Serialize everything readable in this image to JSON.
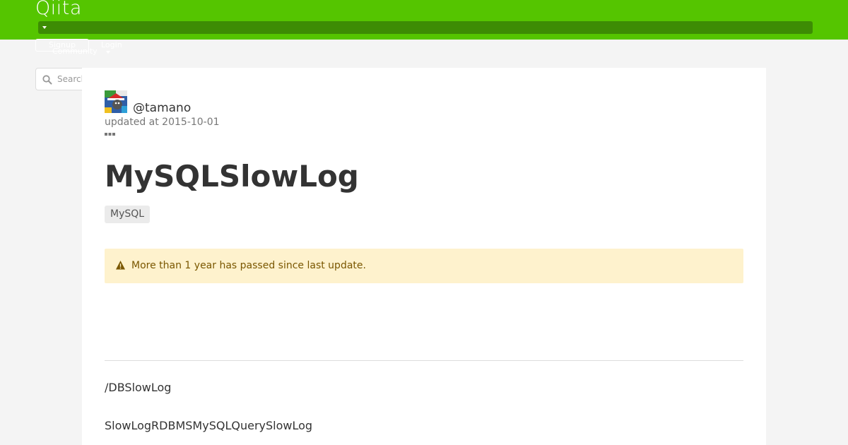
{
  "header": {
    "logo_text": "Qiita",
    "signup_label": "Signup",
    "login_label": "Login",
    "community_label": "Community",
    "brand_color": "#55c500"
  },
  "search": {
    "placeholder": "Search",
    "value": ""
  },
  "article": {
    "author": "@tamano",
    "updated": "updated at 2015-10-01",
    "title": "MySQLSlowLog",
    "tags": [
      "MySQL"
    ],
    "alert": "More than 1 year has passed since last update.",
    "paragraphs": [
      "/DBSlowLog",
      "SlowLogRDBMSMySQLQuerySlowLog"
    ]
  },
  "icons": {
    "search": "search-icon",
    "more": "more-horizontal-icon",
    "alert": "warning-triangle-icon",
    "caret": "caret-down-icon"
  }
}
